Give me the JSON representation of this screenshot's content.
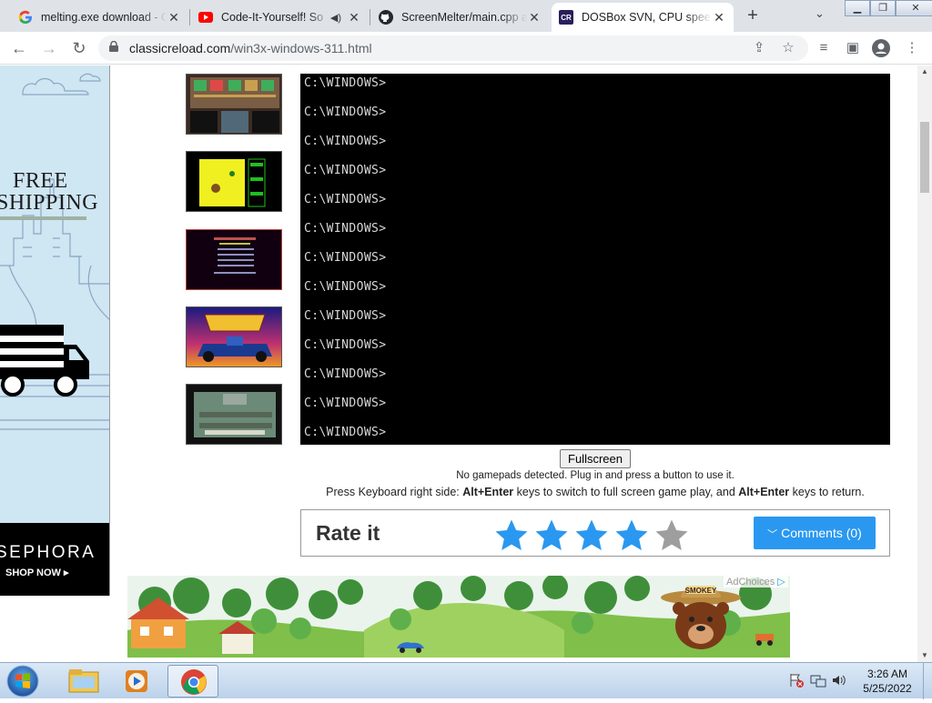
{
  "browser": {
    "tabs": [
      {
        "title": "melting.exe download - C",
        "icon": "google-icon",
        "active": false
      },
      {
        "title": "Code-It-Yourself! So",
        "icon": "youtube-icon",
        "active": false,
        "audio": true
      },
      {
        "title": "ScreenMelter/main.cpp at",
        "icon": "github-icon",
        "active": false
      },
      {
        "title": "DOSBox SVN, CPU speed",
        "icon": "dosbox-icon",
        "active": true
      }
    ],
    "new_tab_label": "+",
    "url_domain": "classicreload.com",
    "url_path": "/win3x-windows-311.html"
  },
  "ad_left": {
    "line1": "FREE",
    "line2": "SHIPPING",
    "brand": "SEPHORA",
    "cta": "SHOP NOW ▸"
  },
  "dos": {
    "prompt": "C:\\WINDOWS>",
    "lines": [
      "C:\\WINDOWS>",
      "C:\\WINDOWS>",
      "C:\\WINDOWS>",
      "C:\\WINDOWS>",
      "C:\\WINDOWS>",
      "C:\\WINDOWS>",
      "C:\\WINDOWS>",
      "C:\\WINDOWS>",
      "C:\\WINDOWS>",
      "C:\\WINDOWS>",
      "C:\\WINDOWS>",
      "C:\\WINDOWS>",
      "C:\\WINDOWS>"
    ]
  },
  "controls": {
    "fullscreen_label": "Fullscreen",
    "gamepad_notice": "No gamepads detected. Plug in and press a button to use it.",
    "kb_hint_pre": "Press Keyboard right side: ",
    "kb_hint_key1": "Alt+Enter",
    "kb_hint_mid": " keys to switch to full screen game play, and ",
    "kb_hint_key2": "Alt+Enter",
    "kb_hint_post": " keys to return."
  },
  "rating": {
    "label": "Rate it",
    "stars_filled": 4,
    "stars_total": 5,
    "comments_label": "Comments (0)",
    "comments_icon": "chevron-down-icon"
  },
  "ad_bottom": {
    "adchoices_label": "AdChoices",
    "sign_text": "SMOKEY"
  },
  "taskbar": {
    "time": "3:26 AM",
    "date": "5/25/2022"
  },
  "colors": {
    "accent": "#2a98f0",
    "star_filled": "#2a98f0",
    "star_empty": "#9e9e9e",
    "dos_bg": "#000000",
    "dos_text": "#d8d8d8"
  }
}
